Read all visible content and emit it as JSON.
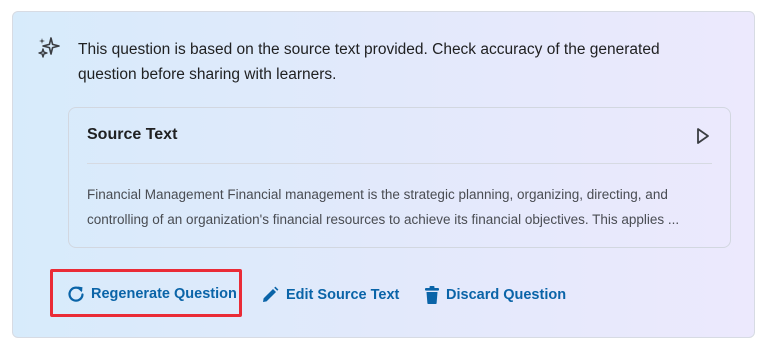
{
  "notice": {
    "icon": "sparkle-icon",
    "text": "This question is based on the source text provided. Check accuracy of the generated question before sharing with learners."
  },
  "source_panel": {
    "title": "Source Text",
    "expand_icon": "triangle-right-icon",
    "body": "Financial Management  Financial management is the strategic planning, organizing, directing, and controlling of an organization's financial resources to achieve its financial objectives. This applies ..."
  },
  "actions": {
    "regenerate": {
      "label": "Regenerate Question",
      "icon": "refresh-icon"
    },
    "edit": {
      "label": "Edit Source Text",
      "icon": "pencil-icon"
    },
    "discard": {
      "label": "Discard Question",
      "icon": "trash-icon"
    }
  },
  "colors": {
    "link": "#0a64a8",
    "highlight": "#ea2b36",
    "text": "#202122"
  }
}
